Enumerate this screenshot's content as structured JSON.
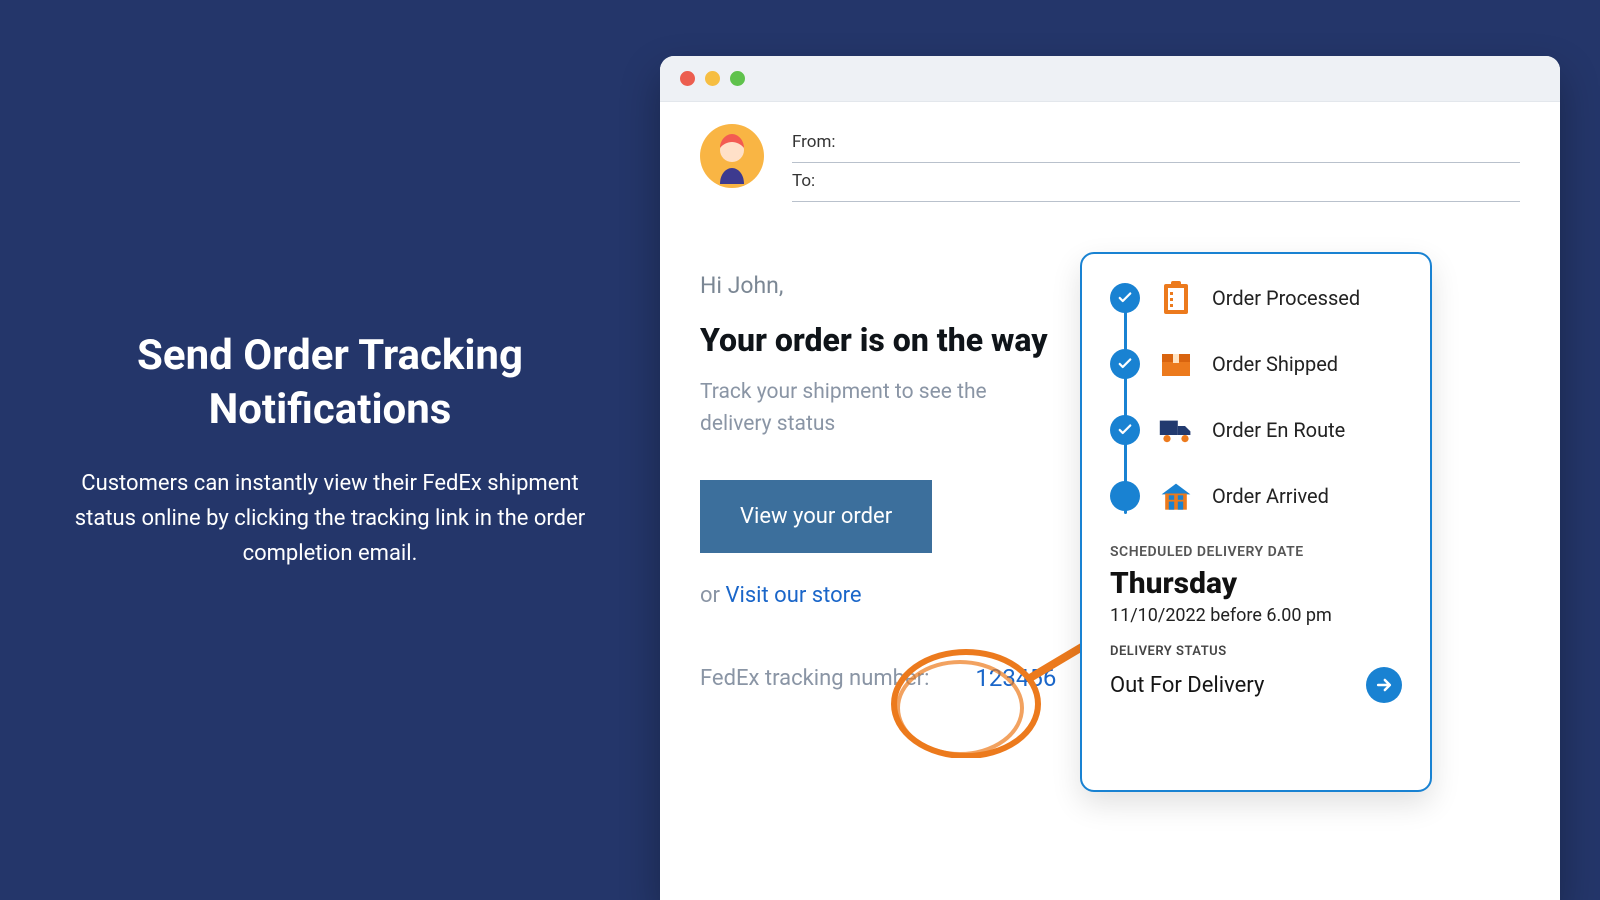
{
  "marketing": {
    "title": "Send Order Tracking Notifications",
    "subtitle": "Customers can instantly view their FedEx shipment status online by clicking the tracking link in the order completion email."
  },
  "email": {
    "from_label": "From:",
    "to_label": "To:",
    "greeting": "Hi John,",
    "headline": "Your order is on the way",
    "subtext": "Track your shipment to see the delivery status",
    "view_order_button": "View your order",
    "or_prefix": "or ",
    "store_link": "Visit our store",
    "tracking_label": "FedEx tracking number:",
    "tracking_number": "123456"
  },
  "tracking": {
    "steps": {
      "processed": "Order Processed",
      "shipped": "Order Shipped",
      "enroute": "Order En Route",
      "arrived": "Order Arrived"
    },
    "scheduled_label": "SCHEDULED DELIVERY DATE",
    "scheduled_day": "Thursday",
    "scheduled_time": "11/10/2022 before 6.00 pm",
    "status_label": "DELIVERY STATUS",
    "status_value": "Out For Delivery"
  },
  "colors": {
    "brand_bg": "#24366a",
    "accent": "#1982d2",
    "orange": "#ec7a1d"
  }
}
